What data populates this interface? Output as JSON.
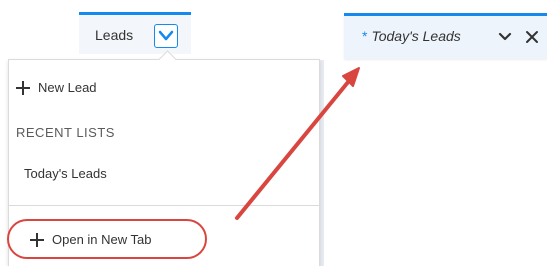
{
  "nav": {
    "tab_label": "Leads"
  },
  "menu": {
    "new_lead_label": "New Lead",
    "recent_lists_header": "RECENT LISTS",
    "recent_list_item": "Today's Leads",
    "open_in_new_tab_label": "Open in New Tab"
  },
  "open_tab": {
    "unsaved_marker": "*",
    "label": "Today's Leads"
  },
  "annotation": {
    "color": "#d9463f"
  },
  "colors": {
    "accent": "#1589ee",
    "text": "#333333"
  }
}
